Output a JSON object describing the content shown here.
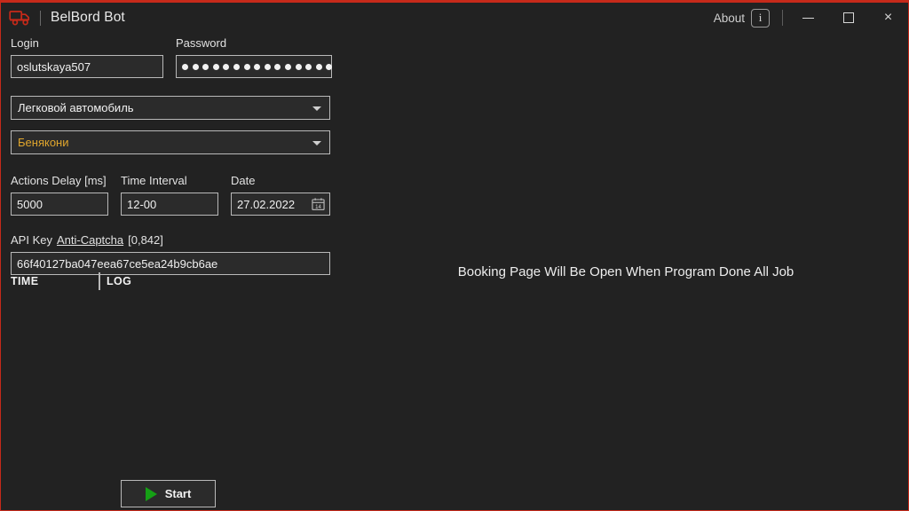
{
  "window": {
    "title": "BelBord Bot",
    "icon": "truck-icon",
    "accent_color": "#c62a1a",
    "background_color": "#222222",
    "about_label": "About",
    "about_icon_glyph": "i",
    "minimize_label": "Minimize",
    "maximize_label": "Maximize",
    "close_label": "Close",
    "close_glyph": "×"
  },
  "form": {
    "login": {
      "label": "Login",
      "value": "oslutskaya507",
      "placeholder": ""
    },
    "password": {
      "label": "Password",
      "masked_length": 15,
      "placeholder": ""
    },
    "vehicle_type": {
      "selected": "Легковой автомобиль",
      "text_color": "#f2f2f2"
    },
    "checkpoint": {
      "selected": "Бенякони",
      "text_color": "#e0a62d"
    },
    "actions_delay": {
      "label": "Actions Delay [ms]",
      "value": "5000"
    },
    "time_interval": {
      "label": "Time Interval",
      "value": "12-00"
    },
    "date": {
      "label": "Date",
      "value": "27.02.2022",
      "calendar_icon_day": "14"
    },
    "api_key": {
      "label": "API Key",
      "link_text": "Anti-Captcha",
      "balance": "[0,842]",
      "value": "66f40127ba047eea67ce5ea24b9cb6ae"
    }
  },
  "log": {
    "columns": [
      "TIME",
      "LOG"
    ],
    "rows": []
  },
  "actions": {
    "start_label": "Start",
    "start_icon": "play-icon",
    "start_icon_color": "#15a015"
  },
  "main": {
    "booking_message": "Booking Page Will Be Open When Program Done All Job"
  }
}
